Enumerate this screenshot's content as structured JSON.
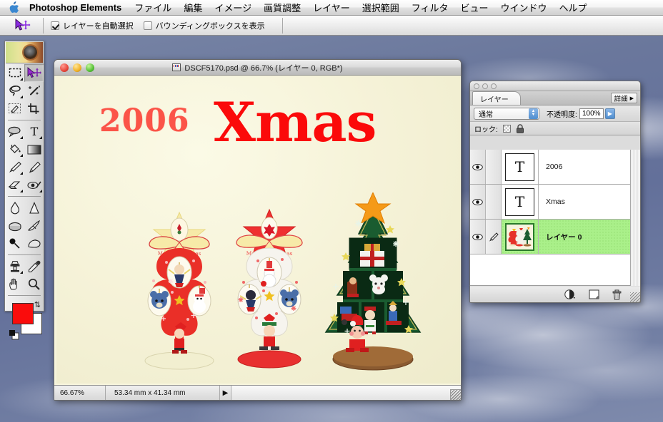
{
  "menubar": {
    "apple_icon": "apple-logo-icon",
    "app_name": "Photoshop Elements",
    "items": [
      {
        "label": "ファイル"
      },
      {
        "label": "編集"
      },
      {
        "label": "イメージ"
      },
      {
        "label": "画質調整"
      },
      {
        "label": "レイヤー"
      },
      {
        "label": "選択範囲"
      },
      {
        "label": "フィルタ"
      },
      {
        "label": "ビュー"
      },
      {
        "label": "ウインドウ"
      },
      {
        "label": "ヘルプ"
      }
    ]
  },
  "options_bar": {
    "tool_icon": "move-tool-icon",
    "auto_select_layer": {
      "label": "レイヤーを自動選択",
      "checked": true
    },
    "show_bounding_box": {
      "label": "バウンディングボックスを表示",
      "checked": false
    }
  },
  "toolbox": {
    "tools": [
      {
        "name": "marquee-tool",
        "icon": "rectangular-marquee-icon"
      },
      {
        "name": "move-tool",
        "icon": "move-tool-icon",
        "selected": true
      },
      {
        "name": "lasso-tool",
        "icon": "lasso-icon"
      },
      {
        "name": "magic-wand-tool",
        "icon": "magic-wand-icon"
      },
      {
        "name": "selection-brush-tool",
        "icon": "selection-brush-icon"
      },
      {
        "name": "crop-tool",
        "icon": "crop-icon"
      },
      {
        "name": "shape-tool",
        "icon": "custom-shape-icon"
      },
      {
        "name": "type-tool",
        "icon": "type-t-icon"
      },
      {
        "name": "paint-bucket-tool",
        "icon": "paint-bucket-icon"
      },
      {
        "name": "gradient-tool",
        "icon": "gradient-icon"
      },
      {
        "name": "brush-tool",
        "icon": "paintbrush-icon"
      },
      {
        "name": "pencil-tool",
        "icon": "pencil-icon"
      },
      {
        "name": "eraser-tool",
        "icon": "eraser-icon"
      },
      {
        "name": "red-eye-tool",
        "icon": "red-eye-brush-icon"
      },
      {
        "name": "blur-tool",
        "icon": "waterdrop-icon"
      },
      {
        "name": "sharpen-tool",
        "icon": "sharpen-cone-icon"
      },
      {
        "name": "sponge-tool",
        "icon": "sponge-icon"
      },
      {
        "name": "smudge-tool",
        "icon": "smudge-finger-icon"
      },
      {
        "name": "dodge-tool",
        "icon": "dodge-icon"
      },
      {
        "name": "burn-tool",
        "icon": "burn-hand-icon"
      },
      {
        "name": "clone-stamp-tool",
        "icon": "clone-stamp-icon"
      },
      {
        "name": "eyedropper-tool",
        "icon": "eyedropper-icon"
      },
      {
        "name": "hand-tool",
        "icon": "hand-icon"
      },
      {
        "name": "zoom-tool",
        "icon": "magnifier-icon"
      }
    ],
    "foreground_color": "#fa0c0c",
    "background_color": "#ffffff"
  },
  "document_window": {
    "title": "DSCF5170.psd @ 66.7% (レイヤー 0, RGB*)",
    "file_icon": "psd-document-icon",
    "traffic_lights": [
      "close-button",
      "minimize-button",
      "zoom-button"
    ],
    "status": {
      "zoom_level": "66.67%",
      "dimensions": "53.34 mm x 41.34 mm",
      "status_arrow": "▶"
    },
    "image": {
      "text_year": "2006",
      "text_xmas": "Xmas",
      "year_color": "#fb5448",
      "xmas_color": "#fb0a0a",
      "background_color": "#f6f3d9",
      "subject": "three wooden christmas tree ornaments"
    }
  },
  "layers_palette": {
    "tab_label": "レイヤー",
    "detail_button": "詳細",
    "detail_arrow": "▶",
    "blend_mode": "通常",
    "opacity_label": "不透明度:",
    "opacity_value": "100%",
    "lock_label": "ロック:",
    "lock_icons": [
      "lock-transparency-icon",
      "lock-all-icon"
    ],
    "layers": [
      {
        "name": "2006",
        "thumb": "T",
        "visible": true,
        "linked": false,
        "selected": false
      },
      {
        "name": "Xmas",
        "thumb": "T",
        "visible": true,
        "linked": false,
        "selected": false
      },
      {
        "name": "レイヤー 0",
        "thumb": "image",
        "visible": true,
        "linked": true,
        "selected": true
      }
    ],
    "bottom_buttons": [
      {
        "name": "new-adjustment-layer-button",
        "icon": "half-circle-icon"
      },
      {
        "name": "new-layer-button",
        "icon": "new-layer-icon"
      },
      {
        "name": "delete-layer-button",
        "icon": "trash-icon"
      }
    ]
  }
}
